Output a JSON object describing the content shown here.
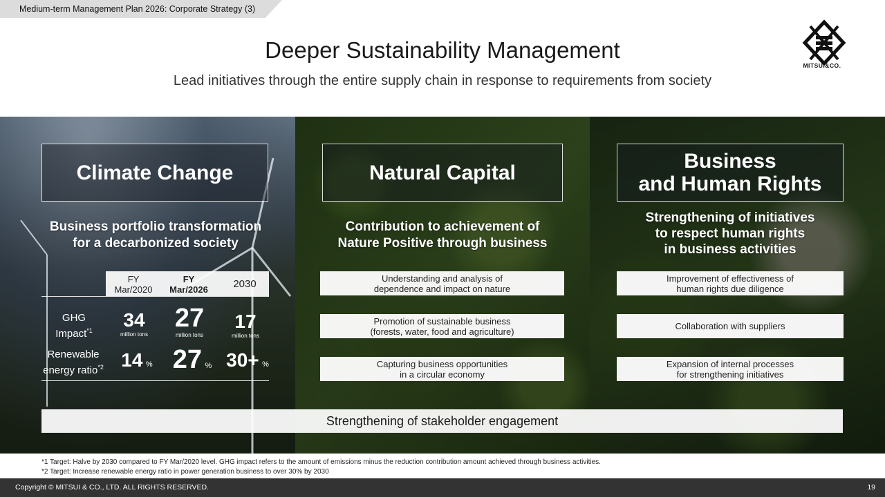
{
  "header": {
    "tab_label": "Medium-term Management Plan 2026: Corporate Strategy (3)",
    "title": "Deeper Sustainability Management",
    "subtitle": "Lead initiatives through the entire supply chain in response to requirements from society",
    "logo_text": "MITSUI&CO."
  },
  "climate": {
    "heading": "Climate Change",
    "subheading_line1": "Business portfolio transformation",
    "subheading_line2": "for a decarbonized society",
    "columns": [
      {
        "line1": "FY",
        "line2": "Mar/2020"
      },
      {
        "line1": "FY",
        "line2": "Mar/2026"
      },
      {
        "line1": "2030",
        "line2": ""
      }
    ],
    "rows": [
      {
        "label_line1": "GHG",
        "label_line2": "Impact",
        "label_sup": "*1",
        "values": [
          {
            "value": "34",
            "unit": "million tons"
          },
          {
            "value": "27",
            "unit": "million tons"
          },
          {
            "value": "17",
            "unit": "million tons"
          }
        ]
      },
      {
        "label_line1": "Renewable",
        "label_line2": "energy ratio",
        "label_sup": "*2",
        "values": [
          {
            "value": "14",
            "unit": "%"
          },
          {
            "value": "27",
            "unit": "%"
          },
          {
            "value": "30+",
            "unit": "%"
          }
        ]
      }
    ]
  },
  "natural": {
    "heading": "Natural Capital",
    "subheading_line1": "Contribution to achievement of",
    "subheading_line2": "Nature Positive through business",
    "items": [
      {
        "line1": "Understanding and analysis of",
        "line2": "dependence and impact on nature"
      },
      {
        "line1": "Promotion of sustainable business",
        "line2": "(forests, water, food and agriculture)"
      },
      {
        "line1": "Capturing business opportunities",
        "line2": "in a circular economy"
      }
    ]
  },
  "rights": {
    "heading_line1": "Business",
    "heading_line2": "and Human Rights",
    "subheading_line1": "Strengthening of initiatives",
    "subheading_line2": "to respect human rights",
    "subheading_line3": "in business activities",
    "items": [
      {
        "line1": "Improvement of effectiveness of",
        "line2": "human rights due diligence"
      },
      {
        "line1": "Collaboration with suppliers",
        "line2": ""
      },
      {
        "line1": "Expansion of internal processes",
        "line2": "for strengthening initiatives"
      }
    ]
  },
  "engagement": "Strengthening of stakeholder engagement",
  "footnotes": [
    "*1 Target: Halve by 2030 compared to FY Mar/2020 level. GHG impact refers to the amount of emissions minus the reduction contribution amount achieved through business activities.",
    "*2 Target: Increase renewable energy ratio in power generation business to over 30% by 2030"
  ],
  "footer": {
    "copyright": "Copyright © MITSUI & CO., LTD. ALL RIGHTS RESERVED.",
    "page_number": "19"
  }
}
